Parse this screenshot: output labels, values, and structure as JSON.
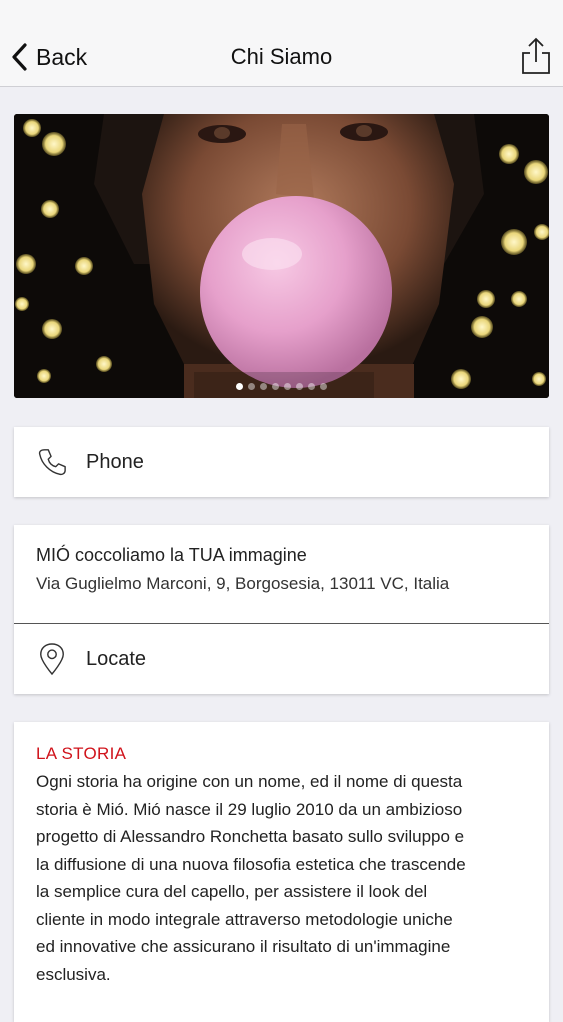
{
  "navbar": {
    "back_label": "Back",
    "title": "Chi Siamo",
    "icons": {
      "back": "chevron-left-icon",
      "share": "share-icon"
    }
  },
  "carousel": {
    "image_alt": "man blowing pink bubble gum",
    "slide_count": 8,
    "active_index": 0
  },
  "phone": {
    "label": "Phone",
    "icon": "phone-icon"
  },
  "location": {
    "name": "MIÓ coccoliamo la TUA immagine",
    "address": "Via Guglielmo Marconi, 9, Borgosesia, 13011 VC, Italia",
    "locate_label": "Locate",
    "icon": "map-pin-icon"
  },
  "story": {
    "heading": "LA STORIA",
    "lines": [
      "Ogni storia ha origine con un nome, ed il nome di questa",
      "storia è Mió. Mió nasce il 29 luglio 2010 da un ambizioso",
      "progetto di Alessandro Ronchetta basato sullo sviluppo e",
      "la diffusione di una nuova filosofia estetica che trascende",
      "la semplice cura del capello, per assistere il look del",
      "cliente in modo integrale attraverso metodologie uniche",
      "ed innovative che assicurano il risultato di un'immagine",
      "esclusiva."
    ]
  },
  "colors": {
    "accent": "#d0131b",
    "background": "#efeff4",
    "navbar": "#f7f7f8"
  }
}
